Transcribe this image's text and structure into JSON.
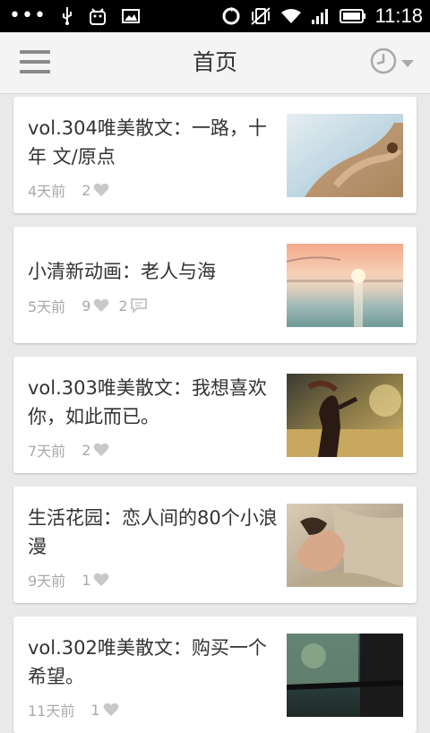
{
  "status_bar": {
    "dots": "•••",
    "time": "11:18",
    "icons": [
      "usb-icon",
      "android-debug-icon",
      "image-icon",
      "sync-icon",
      "vibrate-off-icon",
      "wifi-icon",
      "signal-icon",
      "battery-icon"
    ]
  },
  "app_bar": {
    "title": "首页",
    "menu_icon": "menu-icon",
    "history_icon": "clock-icon"
  },
  "articles": [
    {
      "title": "vol.304唯美散文：一路，十年 文/原点",
      "time": "4天前",
      "likes": "2",
      "comments": ""
    },
    {
      "title": "小清新动画：老人与海",
      "time": "5天前",
      "likes": "9",
      "comments": "2"
    },
    {
      "title": "vol.303唯美散文：我想喜欢你，如此而已。",
      "time": "7天前",
      "likes": "2",
      "comments": ""
    },
    {
      "title": "生活花园：恋人间的80个小浪漫",
      "time": "9天前",
      "likes": "1",
      "comments": ""
    },
    {
      "title": "vol.302唯美散文：购买一个希望。",
      "time": "11天前",
      "likes": "1",
      "comments": ""
    }
  ],
  "colors": {
    "app_bar": "#f4f4f4",
    "background": "#e9e9e9",
    "meta_text": "#a9a9a9",
    "title_text": "#333333"
  }
}
